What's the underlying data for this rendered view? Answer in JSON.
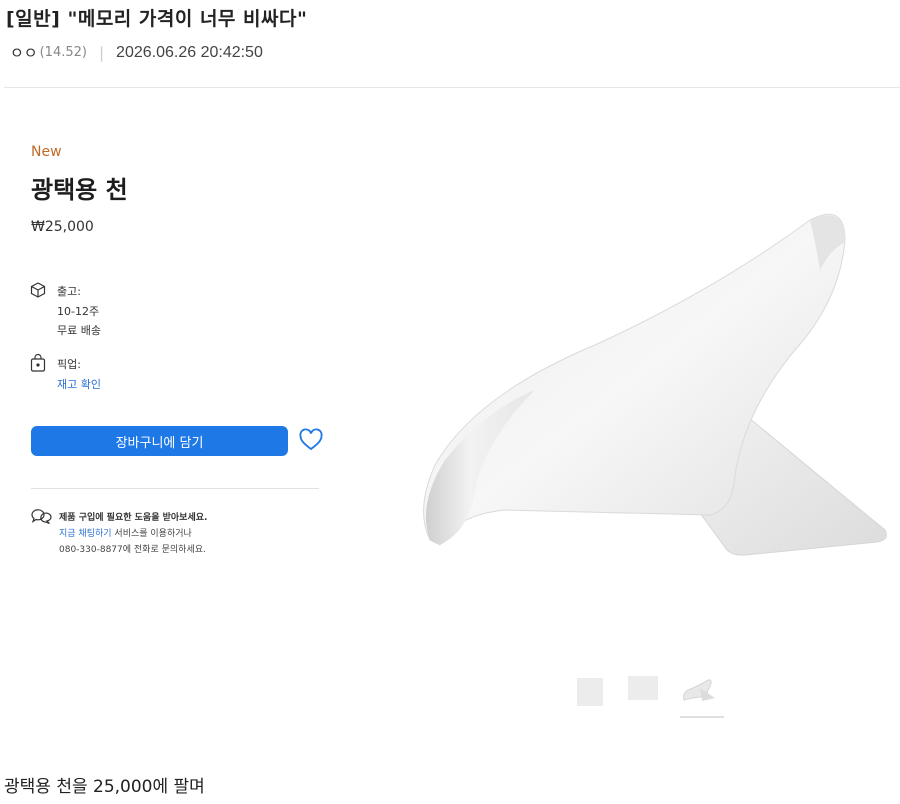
{
  "post": {
    "title": "[일반] \"메모리 가격이 너무 비싸다\"",
    "author": "ㅇㅇ",
    "ip": "(14.52)",
    "separator": "|",
    "datetime": "2026.06.26 20:42:50"
  },
  "product": {
    "badge": "New",
    "title": "광택용 천",
    "price": "₩25,000",
    "shipping_label": "출고:",
    "shipping_weeks": "10-12주",
    "shipping_free": "무료 배송",
    "pickup_label": "픽업:",
    "stock_link": "재고 확인",
    "cart_button": "장바구니에 담기",
    "help_line1": "제품 구입에 필요한 도움을 받아보세요.",
    "help_line2_link": "지금 채팅하기",
    "help_line2_rest": " 서비스를 이용하거나",
    "help_line3": "080-330-8877에 전화로 문의하세요.",
    "colors": {
      "accent": "#1e78e6",
      "badge": "#c06a2a",
      "link": "#2a6fd1"
    }
  },
  "caption": "광택용 천을 25,000에 팔며"
}
